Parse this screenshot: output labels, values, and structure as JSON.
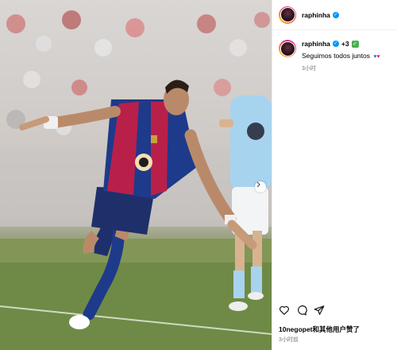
{
  "header": {
    "username": "raphinha"
  },
  "caption": {
    "username": "raphinha",
    "collaborators": "+3",
    "text": "Seguimos todos juntos",
    "hearts": [
      "blue-heart",
      "red-heart"
    ],
    "time": "3小时"
  },
  "actions": [
    "heart-icon",
    "comment-icon",
    "share-icon"
  ],
  "likes_text": "10negopet和其他用户赞了",
  "post_time": "3小时前",
  "colors": {
    "verified": "#0095f6",
    "jersey_blue": "#1e3a8a",
    "jersey_red": "#b8204a",
    "pitch": "#6f8a46",
    "opponent_kit": "#a8d3ee"
  }
}
